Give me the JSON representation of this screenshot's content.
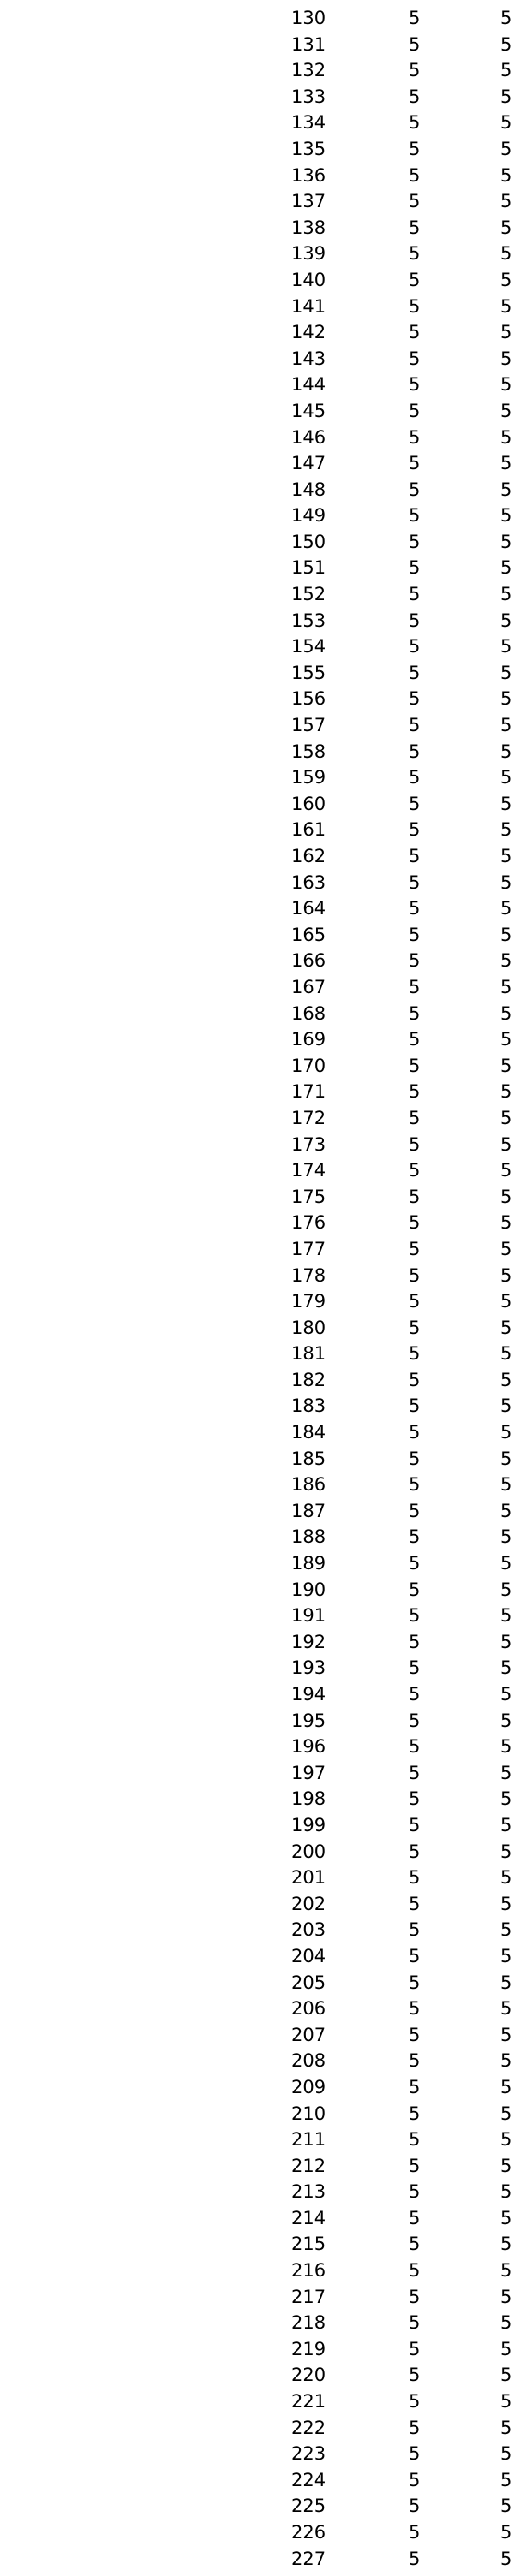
{
  "rows": [
    [
      "130",
      "5",
      "5"
    ],
    [
      "131",
      "5",
      "5"
    ],
    [
      "132",
      "5",
      "5"
    ],
    [
      "133",
      "5",
      "5"
    ],
    [
      "134",
      "5",
      "5"
    ],
    [
      "135",
      "5",
      "5"
    ],
    [
      "136",
      "5",
      "5"
    ],
    [
      "137",
      "5",
      "5"
    ],
    [
      "138",
      "5",
      "5"
    ],
    [
      "139",
      "5",
      "5"
    ],
    [
      "140",
      "5",
      "5"
    ],
    [
      "141",
      "5",
      "5"
    ],
    [
      "142",
      "5",
      "5"
    ],
    [
      "143",
      "5",
      "5"
    ],
    [
      "144",
      "5",
      "5"
    ],
    [
      "145",
      "5",
      "5"
    ],
    [
      "146",
      "5",
      "5"
    ],
    [
      "147",
      "5",
      "5"
    ],
    [
      "148",
      "5",
      "5"
    ],
    [
      "149",
      "5",
      "5"
    ],
    [
      "150",
      "5",
      "5"
    ],
    [
      "151",
      "5",
      "5"
    ],
    [
      "152",
      "5",
      "5"
    ],
    [
      "153",
      "5",
      "5"
    ],
    [
      "154",
      "5",
      "5"
    ],
    [
      "155",
      "5",
      "5"
    ],
    [
      "156",
      "5",
      "5"
    ],
    [
      "157",
      "5",
      "5"
    ],
    [
      "158",
      "5",
      "5"
    ],
    [
      "159",
      "5",
      "5"
    ],
    [
      "160",
      "5",
      "5"
    ],
    [
      "161",
      "5",
      "5"
    ],
    [
      "162",
      "5",
      "5"
    ],
    [
      "163",
      "5",
      "5"
    ],
    [
      "164",
      "5",
      "5"
    ],
    [
      "165",
      "5",
      "5"
    ],
    [
      "166",
      "5",
      "5"
    ],
    [
      "167",
      "5",
      "5"
    ],
    [
      "168",
      "5",
      "5"
    ],
    [
      "169",
      "5",
      "5"
    ],
    [
      "170",
      "5",
      "5"
    ],
    [
      "171",
      "5",
      "5"
    ],
    [
      "172",
      "5",
      "5"
    ],
    [
      "173",
      "5",
      "5"
    ],
    [
      "174",
      "5",
      "5"
    ],
    [
      "175",
      "5",
      "5"
    ],
    [
      "176",
      "5",
      "5"
    ],
    [
      "177",
      "5",
      "5"
    ],
    [
      "178",
      "5",
      "5"
    ],
    [
      "179",
      "5",
      "5"
    ],
    [
      "180",
      "5",
      "5"
    ],
    [
      "181",
      "5",
      "5"
    ],
    [
      "182",
      "5",
      "5"
    ],
    [
      "183",
      "5",
      "5"
    ],
    [
      "184",
      "5",
      "5"
    ],
    [
      "185",
      "5",
      "5"
    ],
    [
      "186",
      "5",
      "5"
    ],
    [
      "187",
      "5",
      "5"
    ],
    [
      "188",
      "5",
      "5"
    ],
    [
      "189",
      "5",
      "5"
    ],
    [
      "190",
      "5",
      "5"
    ],
    [
      "191",
      "5",
      "5"
    ],
    [
      "192",
      "5",
      "5"
    ],
    [
      "193",
      "5",
      "5"
    ],
    [
      "194",
      "5",
      "5"
    ],
    [
      "195",
      "5",
      "5"
    ],
    [
      "196",
      "5",
      "5"
    ],
    [
      "197",
      "5",
      "5"
    ],
    [
      "198",
      "5",
      "5"
    ],
    [
      "199",
      "5",
      "5"
    ],
    [
      "200",
      "5",
      "5"
    ],
    [
      "201",
      "5",
      "5"
    ],
    [
      "202",
      "5",
      "5"
    ],
    [
      "203",
      "5",
      "5"
    ],
    [
      "204",
      "5",
      "5"
    ],
    [
      "205",
      "5",
      "5"
    ],
    [
      "206",
      "5",
      "5"
    ],
    [
      "207",
      "5",
      "5"
    ],
    [
      "208",
      "5",
      "5"
    ],
    [
      "209",
      "5",
      "5"
    ],
    [
      "210",
      "5",
      "5"
    ],
    [
      "211",
      "5",
      "5"
    ],
    [
      "212",
      "5",
      "5"
    ],
    [
      "213",
      "5",
      "5"
    ],
    [
      "214",
      "5",
      "5"
    ],
    [
      "215",
      "5",
      "5"
    ],
    [
      "216",
      "5",
      "5"
    ],
    [
      "217",
      "5",
      "5"
    ],
    [
      "218",
      "5",
      "5"
    ],
    [
      "219",
      "5",
      "5"
    ],
    [
      "220",
      "5",
      "5"
    ],
    [
      "221",
      "5",
      "5"
    ],
    [
      "222",
      "5",
      "5"
    ],
    [
      "223",
      "5",
      "5"
    ],
    [
      "224",
      "5",
      "5"
    ],
    [
      "225",
      "5",
      "5"
    ],
    [
      "226",
      "5",
      "5"
    ],
    [
      "227",
      "5",
      "5"
    ]
  ]
}
